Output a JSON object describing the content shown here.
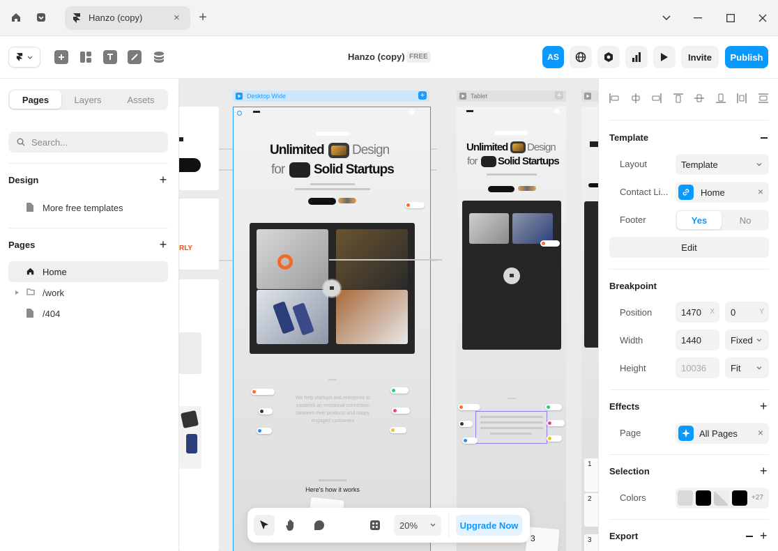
{
  "titlebar": {
    "tab_title": "Hanzo (copy)"
  },
  "toolbar": {
    "project_name": "Hanzo (copy)",
    "plan_badge": "FREE",
    "avatar_initials": "AS",
    "invite_label": "Invite",
    "publish_label": "Publish"
  },
  "left_panel": {
    "tabs": [
      "Pages",
      "Layers",
      "Assets"
    ],
    "search_placeholder": "Search...",
    "design_section": {
      "title": "Design",
      "items": [
        "More free templates"
      ]
    },
    "pages_section": {
      "title": "Pages",
      "items": [
        "Home",
        "/work",
        "/404"
      ]
    }
  },
  "canvas": {
    "frames": [
      {
        "label": "Desktop Wide",
        "headline_1": "Unlimited",
        "headline_1b": "Design",
        "headline_2a": "for",
        "headline_2b": "Solid Startups",
        "section_heading": "Here's how it works",
        "paragraph": "We help startups and enterprise to establish an emotional connection between their products and happy engaged customers"
      },
      {
        "label": "Tablet",
        "headline_1": "Unlimited",
        "headline_1b": "Design",
        "headline_2a": "for",
        "headline_2b": "Solid Startups"
      }
    ],
    "left_fragment_text": "RLY",
    "cards_numbers": [
      "1",
      "2",
      "3"
    ],
    "bottom_number": "3"
  },
  "bottom_toolbar": {
    "zoom": "20%",
    "upgrade_label": "Upgrade Now"
  },
  "right_panel": {
    "template": {
      "title": "Template",
      "layout_label": "Layout",
      "layout_value": "Template",
      "contact_label": "Contact Li...",
      "contact_value": "Home",
      "footer_label": "Footer",
      "footer_yes": "Yes",
      "footer_no": "No",
      "edit_label": "Edit"
    },
    "breakpoint": {
      "title": "Breakpoint",
      "position_label": "Position",
      "position_x": "1470",
      "position_x_unit": "X",
      "position_y": "0",
      "position_y_unit": "Y",
      "width_label": "Width",
      "width_value": "1440",
      "width_mode": "Fixed",
      "height_label": "Height",
      "height_value": "10036",
      "height_mode": "Fit"
    },
    "effects": {
      "title": "Effects",
      "page_label": "Page",
      "page_value": "All Pages"
    },
    "selection": {
      "title": "Selection",
      "colors_label": "Colors",
      "more_colors": "+27",
      "swatches": [
        "#d9d9d9",
        "#000000",
        "#cfcfcf",
        "#000000"
      ]
    },
    "export": {
      "title": "Export"
    }
  },
  "colors": {
    "accent": "#0a99ff",
    "canvas_bg": "#ebebeb",
    "frame_selected": "#1e9bff"
  }
}
